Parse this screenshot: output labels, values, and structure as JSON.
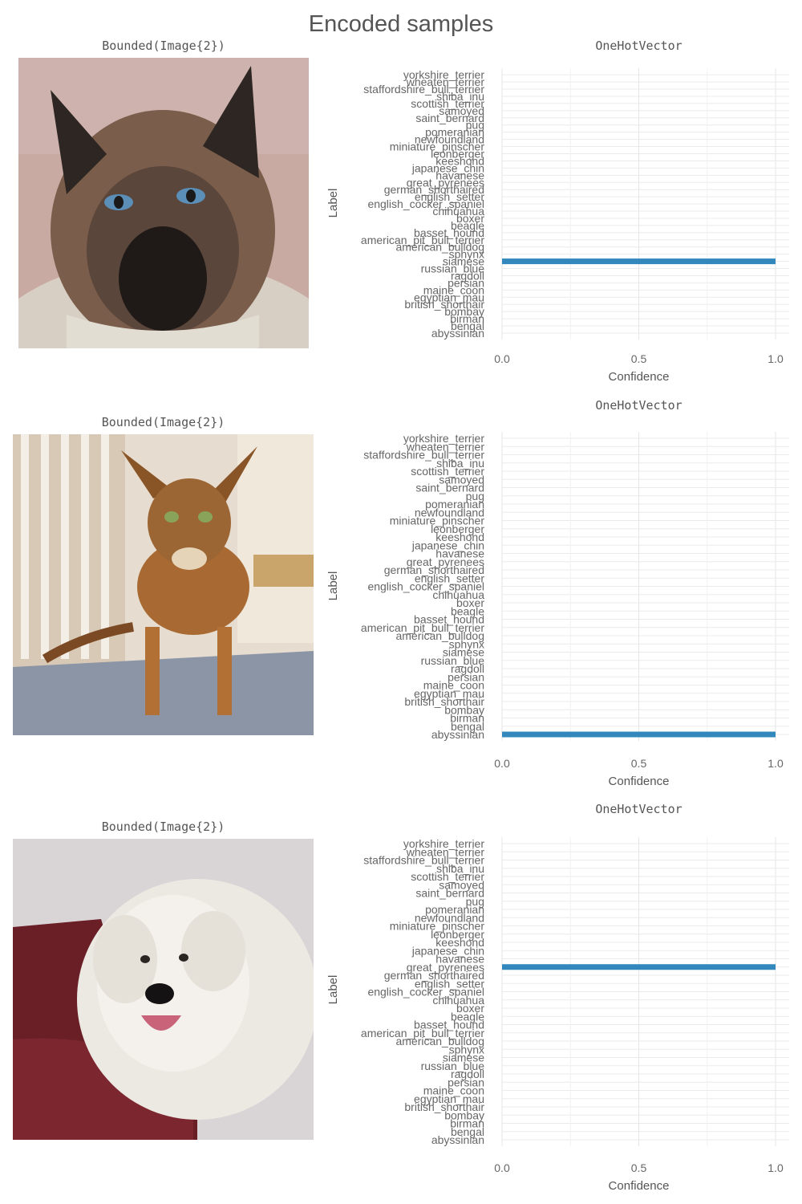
{
  "title": "Encoded samples",
  "samples": [
    {
      "image_label": "Bounded(Image{2})",
      "image_description_icon": "siamese-cat-photo",
      "chart_title": "OneHotVector",
      "chart_data": {
        "type": "bar",
        "orientation": "horizontal",
        "categories": [
          "abyssinian",
          "bengal",
          "birman",
          "bombay",
          "british_shorthair",
          "egyptian_mau",
          "maine_coon",
          "persian",
          "ragdoll",
          "russian_blue",
          "siamese",
          "sphynx",
          "american_bulldog",
          "american_pit_bull_terrier",
          "basset_hound",
          "beagle",
          "boxer",
          "chihuahua",
          "english_cocker_spaniel",
          "english_setter",
          "german_shorthaired",
          "great_pyrenees",
          "havanese",
          "japanese_chin",
          "keeshond",
          "leonberger",
          "miniature_pinscher",
          "newfoundland",
          "pomeranian",
          "pug",
          "saint_bernard",
          "samoyed",
          "scottish_terrier",
          "shiba_inu",
          "staffordshire_bull_terrier",
          "wheaten_terrier",
          "yorkshire_terrier"
        ],
        "values": [
          0,
          0,
          0,
          0,
          0,
          0,
          0,
          0,
          0,
          0,
          1,
          0,
          0,
          0,
          0,
          0,
          0,
          0,
          0,
          0,
          0,
          0,
          0,
          0,
          0,
          0,
          0,
          0,
          0,
          0,
          0,
          0,
          0,
          0,
          0,
          0,
          0
        ],
        "xlabel": "Confidence",
        "ylabel": "Label",
        "xlim": [
          0,
          1
        ],
        "xticks": [
          "0.0",
          "0.5",
          "1.0"
        ],
        "grid": true,
        "bar_color": "#3288bd"
      }
    },
    {
      "image_label": "Bounded(Image{2})",
      "image_description_icon": "abyssinian-cat-photo",
      "chart_title": "OneHotVector",
      "chart_data": {
        "type": "bar",
        "orientation": "horizontal",
        "categories": [
          "abyssinian",
          "bengal",
          "birman",
          "bombay",
          "british_shorthair",
          "egyptian_mau",
          "maine_coon",
          "persian",
          "ragdoll",
          "russian_blue",
          "siamese",
          "sphynx",
          "american_bulldog",
          "american_pit_bull_terrier",
          "basset_hound",
          "beagle",
          "boxer",
          "chihuahua",
          "english_cocker_spaniel",
          "english_setter",
          "german_shorthaired",
          "great_pyrenees",
          "havanese",
          "japanese_chin",
          "keeshond",
          "leonberger",
          "miniature_pinscher",
          "newfoundland",
          "pomeranian",
          "pug",
          "saint_bernard",
          "samoyed",
          "scottish_terrier",
          "shiba_inu",
          "staffordshire_bull_terrier",
          "wheaten_terrier",
          "yorkshire_terrier"
        ],
        "values": [
          1,
          0,
          0,
          0,
          0,
          0,
          0,
          0,
          0,
          0,
          0,
          0,
          0,
          0,
          0,
          0,
          0,
          0,
          0,
          0,
          0,
          0,
          0,
          0,
          0,
          0,
          0,
          0,
          0,
          0,
          0,
          0,
          0,
          0,
          0,
          0,
          0
        ],
        "xlabel": "Confidence",
        "ylabel": "Label",
        "xlim": [
          0,
          1
        ],
        "xticks": [
          "0.0",
          "0.5",
          "1.0"
        ],
        "grid": true,
        "bar_color": "#3288bd"
      }
    },
    {
      "image_label": "Bounded(Image{2})",
      "image_description_icon": "great-pyrenees-dog-photo",
      "chart_title": "OneHotVector",
      "chart_data": {
        "type": "bar",
        "orientation": "horizontal",
        "categories": [
          "abyssinian",
          "bengal",
          "birman",
          "bombay",
          "british_shorthair",
          "egyptian_mau",
          "maine_coon",
          "persian",
          "ragdoll",
          "russian_blue",
          "siamese",
          "sphynx",
          "american_bulldog",
          "american_pit_bull_terrier",
          "basset_hound",
          "beagle",
          "boxer",
          "chihuahua",
          "english_cocker_spaniel",
          "english_setter",
          "german_shorthaired",
          "great_pyrenees",
          "havanese",
          "japanese_chin",
          "keeshond",
          "leonberger",
          "miniature_pinscher",
          "newfoundland",
          "pomeranian",
          "pug",
          "saint_bernard",
          "samoyed",
          "scottish_terrier",
          "shiba_inu",
          "staffordshire_bull_terrier",
          "wheaten_terrier",
          "yorkshire_terrier"
        ],
        "values": [
          0,
          0,
          0,
          0,
          0,
          0,
          0,
          0,
          0,
          0,
          0,
          0,
          0,
          0,
          0,
          0,
          0,
          0,
          0,
          0,
          0,
          1,
          0,
          0,
          0,
          0,
          0,
          0,
          0,
          0,
          0,
          0,
          0,
          0,
          0,
          0,
          0
        ],
        "xlabel": "Confidence",
        "ylabel": "Label",
        "xlim": [
          0,
          1
        ],
        "xticks": [
          "0.0",
          "0.5",
          "1.0"
        ],
        "grid": true,
        "bar_color": "#3288bd"
      }
    }
  ]
}
